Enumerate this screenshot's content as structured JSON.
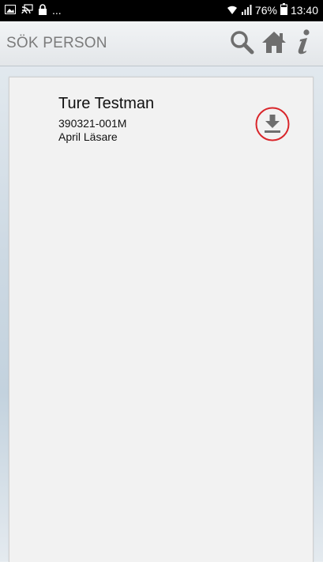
{
  "status_bar": {
    "left_icons": [
      "image-icon",
      "cast-icon",
      "lock-icon"
    ],
    "ellipsis": "...",
    "battery_percent": "76%",
    "time": "13:40"
  },
  "header": {
    "title": "SÖK PERSON",
    "icons": [
      "search-icon",
      "home-icon",
      "info-icon"
    ]
  },
  "person": {
    "name": "Ture Testman",
    "id": "390321-001M",
    "role": "April Läsare"
  },
  "colors": {
    "highlight_ring": "#d9262b",
    "icon_gray": "#6e6e6e"
  }
}
